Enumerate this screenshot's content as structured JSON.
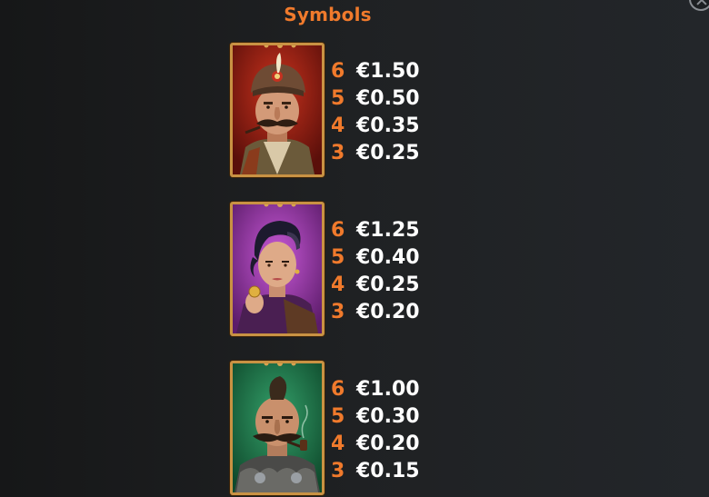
{
  "header": {
    "title": "Symbols"
  },
  "colors": {
    "accent": "#f07a2c",
    "value_text": "#ffffff",
    "frame_gold": "#c99243"
  },
  "symbols": [
    {
      "name": "noble-with-turban",
      "payouts": [
        {
          "count": "6",
          "value": "€1.50"
        },
        {
          "count": "5",
          "value": "€0.50"
        },
        {
          "count": "4",
          "value": "€0.35"
        },
        {
          "count": "3",
          "value": "€0.25"
        }
      ]
    },
    {
      "name": "woman-with-undercut",
      "payouts": [
        {
          "count": "6",
          "value": "€1.25"
        },
        {
          "count": "5",
          "value": "€0.40"
        },
        {
          "count": "4",
          "value": "€0.25"
        },
        {
          "count": "3",
          "value": "€0.20"
        }
      ]
    },
    {
      "name": "man-with-pipe",
      "payouts": [
        {
          "count": "6",
          "value": "€1.00"
        },
        {
          "count": "5",
          "value": "€0.30"
        },
        {
          "count": "4",
          "value": "€0.20"
        },
        {
          "count": "3",
          "value": "€0.15"
        }
      ]
    }
  ]
}
